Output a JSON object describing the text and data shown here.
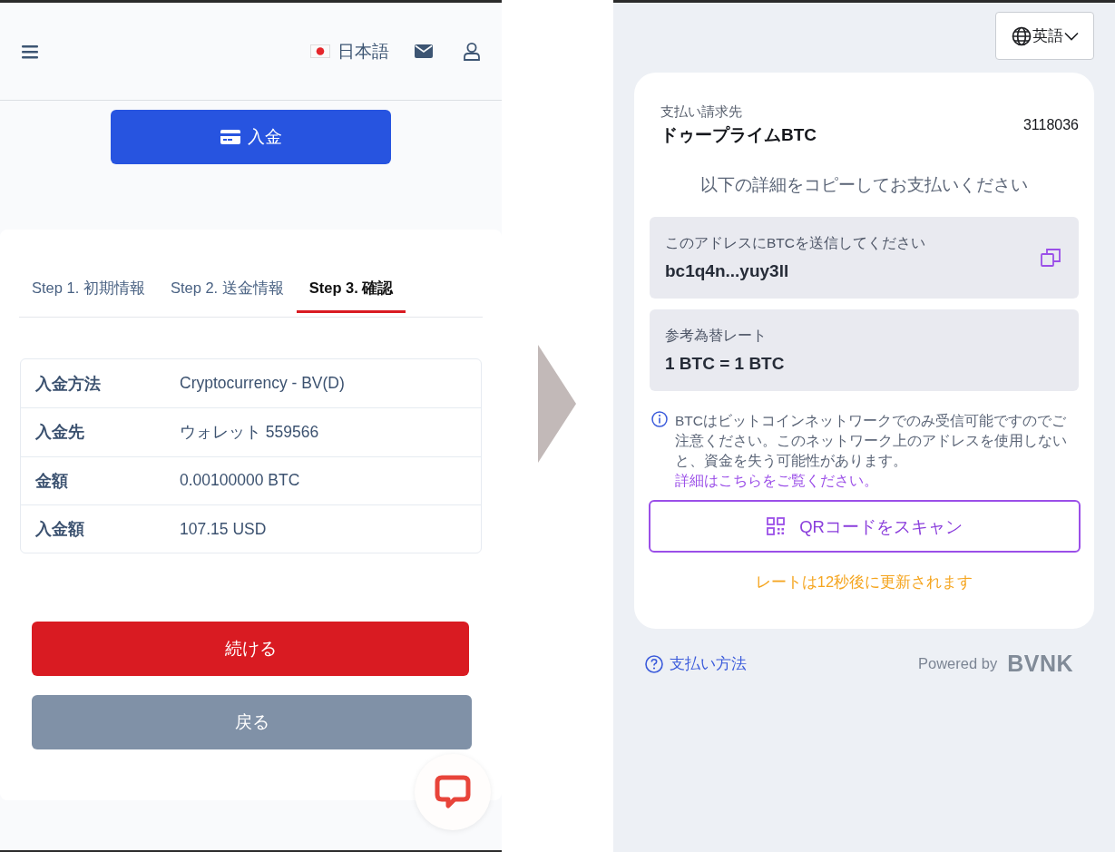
{
  "left": {
    "header": {
      "language": "日本語"
    },
    "deposit_button": "入金",
    "steps": [
      {
        "label": "Step 1. 初期情報",
        "selected": false
      },
      {
        "label": "Step 2. 送金情報",
        "selected": false
      },
      {
        "label": "Step 3. 確認",
        "selected": true
      }
    ],
    "summary": [
      {
        "label": "入金方法",
        "value": "Cryptocurrency - BV(D)"
      },
      {
        "label": "入金先",
        "value": "ウォレット 559566"
      },
      {
        "label": "金額",
        "value": "0.00100000 BTC"
      },
      {
        "label": "入金額",
        "value": "107.15 USD"
      }
    ],
    "buttons": [
      {
        "label": "続ける",
        "kind": "primary"
      },
      {
        "label": "戻る",
        "kind": "secondary"
      }
    ]
  },
  "right": {
    "language_button": "英語",
    "payee_label": "支払い請求先",
    "payee_name": "ドゥープライムBTC",
    "invoice_number": "3118036",
    "instruction": "以下の詳細をコピーしてお支払いください",
    "fields": [
      {
        "label": "このアドレスにBTCを送信してください",
        "value": "bc1q4n...yuy3ll",
        "copyable": true
      },
      {
        "label": "参考為替レート",
        "value": "1 BTC = 1 BTC",
        "copyable": false
      }
    ],
    "notice": {
      "text": "BTCはビットコインネットワークでのみ受信可能ですのでご注意ください。このネットワーク上のアドレスを使用しないと、資金を失う可能性があります。",
      "link": "詳細はこちらをご覧ください。"
    },
    "qr_button": "QRコードをスキャン",
    "rate_notice": "レートは12秒後に更新されます",
    "help_link": "支払い方法",
    "powered_by": "Powered by",
    "brand": "BVNK"
  }
}
